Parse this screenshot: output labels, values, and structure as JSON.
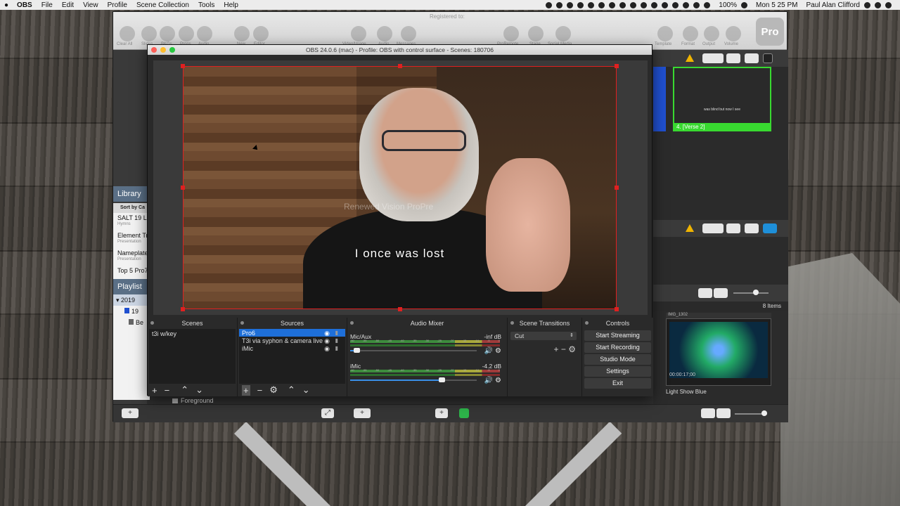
{
  "menubar": {
    "app": "OBS",
    "items": [
      "File",
      "Edit",
      "View",
      "Profile",
      "Scene Collection",
      "Tools",
      "Help"
    ],
    "battery": "100%",
    "clock": "Mon 5 25 PM",
    "user": "Paul Alan Clifford"
  },
  "propresenter": {
    "registered": "Registered to:",
    "logo": "Pro",
    "toolbar_labels": [
      "Clear All",
      "Slides",
      "BKGs",
      "Props",
      "Audio",
      "New",
      "Editor",
      "Video/Image",
      "Audio",
      "Messages",
      "ProRemote",
      "Stage",
      "Social Media",
      "Template",
      "Format",
      "Output",
      "Volume"
    ],
    "library": {
      "title": "Library",
      "sort_label": "Sort by Ca",
      "items": [
        {
          "name": "SALT 19 Lo",
          "sub": "Hymns"
        },
        {
          "name": "Element Tr",
          "sub": "Presentation"
        },
        {
          "name": "Nameplate",
          "sub": "Presentation"
        },
        {
          "name": "Top 5 Pro7",
          "sub": ""
        }
      ]
    },
    "playlist": {
      "title": "Playlist",
      "rows": [
        "2019",
        "19",
        "Be"
      ]
    },
    "slide": {
      "label": "4. [Verse 2]",
      "text": "was blind but now I see"
    },
    "items_count": "8 Items",
    "media": {
      "top_label": "IMG_1302",
      "time": "00:00:17;00",
      "name": "Light Show Blue"
    },
    "foreground_label": "Foreground"
  },
  "obs": {
    "title": "OBS 24.0.6 (mac) - Profile: OBS with control surface - Scenes: 180706",
    "lower_third": "I once was lost",
    "watermark": "Renewed Vision ProPre",
    "docks": {
      "scenes": {
        "title": "Scenes",
        "items": [
          "t3i w/key"
        ]
      },
      "sources": {
        "title": "Sources",
        "items": [
          "Pro6",
          "T3i via syphon & camera live",
          "iMic"
        ]
      },
      "mixer": {
        "title": "Audio Mixer",
        "ticks": [
          "-60",
          "-55",
          "-50",
          "-45",
          "-40",
          "-35",
          "-30",
          "-25",
          "-20",
          "-15",
          "-10",
          "-5",
          "0"
        ],
        "channels": [
          {
            "name": "Mic/Aux",
            "db": "-inf dB",
            "volume": 0.05
          },
          {
            "name": "iMic",
            "db": "-4.2 dB",
            "volume": 0.72
          }
        ]
      },
      "transitions": {
        "title": "Scene Transitions",
        "selected": "Cut"
      },
      "controls": {
        "title": "Controls",
        "buttons": [
          "Start Streaming",
          "Start Recording",
          "Studio Mode",
          "Settings",
          "Exit"
        ]
      }
    }
  }
}
